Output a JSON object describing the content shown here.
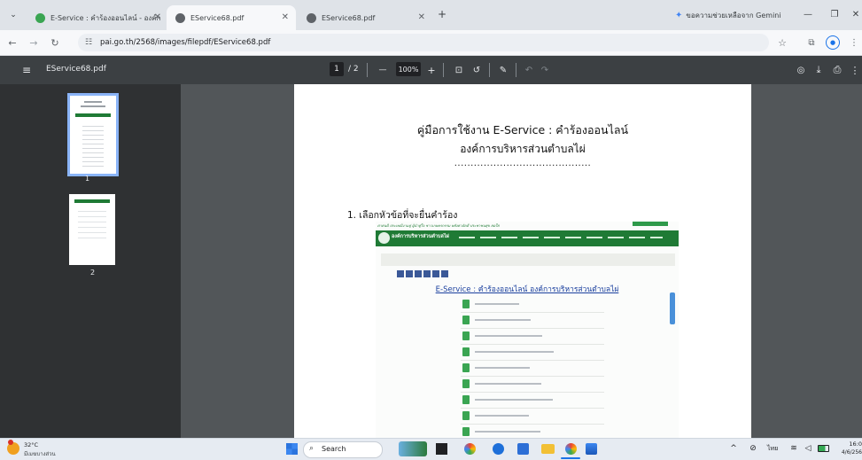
{
  "tabs": [
    {
      "title": "E-Service : คำร้องออนไลน์ - องค์ก",
      "active": false
    },
    {
      "title": "EService68.pdf",
      "active": true
    },
    {
      "title": "EService68.pdf",
      "active": false
    }
  ],
  "new_tab_symbol": "+",
  "gemini_label": "ขอความช่วยเหลือจาก Gemini",
  "address": {
    "url": "pai.go.th/2568/images/filepdf/EService68.pdf"
  },
  "pdf_toolbar": {
    "filename": "EService68.pdf",
    "current_page": "1",
    "page_total": "/ 2",
    "zoom": "100%",
    "zoom_minus": "—",
    "zoom_plus": "+"
  },
  "thumbnails": [
    {
      "label": "1",
      "selected": true
    },
    {
      "label": "2",
      "selected": false
    }
  ],
  "document": {
    "title_line1": "คู่มือการใช้งาน E-Service : คำร้องออนไลน์",
    "title_line2": "องค์การบริหารส่วนตำบลไผ่",
    "dots": "..........................................",
    "section": "1. เลือกหัวข้อที่จะยื่นคำร้อง",
    "banner_slogan": "ศาสนดี ประเพณีงามคู่ ผู้นำสู่ใจ ชาวเกษตรกรรม พลังสามัคคี ประชาชนสุข สดใส",
    "banner_org": "องค์การบริหารส่วนตำบลไผ่",
    "embedded_heading": "E-Service : คำร้องออนไลน์ องค์การบริหารส่วนตำบลไผ่",
    "list_count": 9
  },
  "taskbar": {
    "weather_temp": "32°C",
    "weather_desc": "มีเมฆบางส่วน",
    "search_label": "Search",
    "lang": "ไทย",
    "time": "16:0",
    "date": "4/6/256"
  },
  "colors": {
    "tabstrip": "#dfe3e8",
    "pdf_toolbar": "#3c4043",
    "viewer_bg": "#525659",
    "banner_green": "#1f7a35",
    "link_blue": "#1a3f9e"
  }
}
